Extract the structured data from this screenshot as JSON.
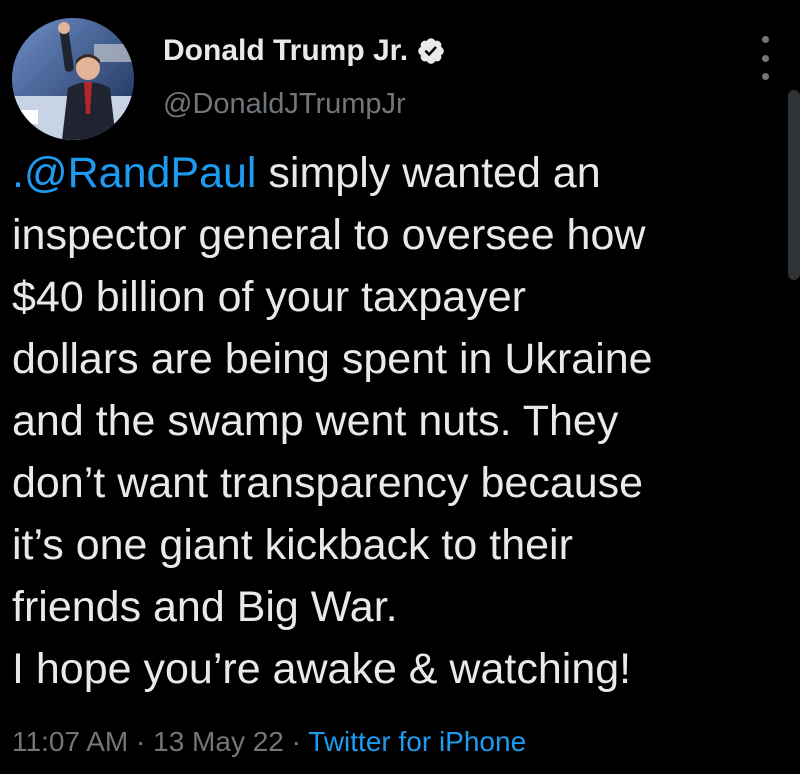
{
  "author": {
    "display_name": "Donald Trump Jr.",
    "handle": "@DonaldJTrumpJr",
    "verified": true,
    "avatar_icon": "profile-photo"
  },
  "tweet": {
    "mention": ".@RandPaul",
    "lines": [
      " simply wanted an",
      "inspector general to oversee how",
      "$40 billion of your taxpayer",
      "dollars are being spent in Ukraine",
      "and the swamp went nuts. They",
      "don’t want transparency because",
      "it’s one giant kickback to their",
      "friends and Big War.",
      "I hope you’re awake & watching!"
    ]
  },
  "meta": {
    "time": "11:07 AM",
    "sep1": " · ",
    "date": "13 May 22",
    "sep2": " · ",
    "source": "Twitter for iPhone"
  },
  "colors": {
    "background": "#000000",
    "text": "#e7e9ea",
    "secondary": "#71767b",
    "accent": "#1d9bf0"
  },
  "icons": {
    "more": "more-vertical-icon",
    "verified": "verified-badge-icon"
  }
}
